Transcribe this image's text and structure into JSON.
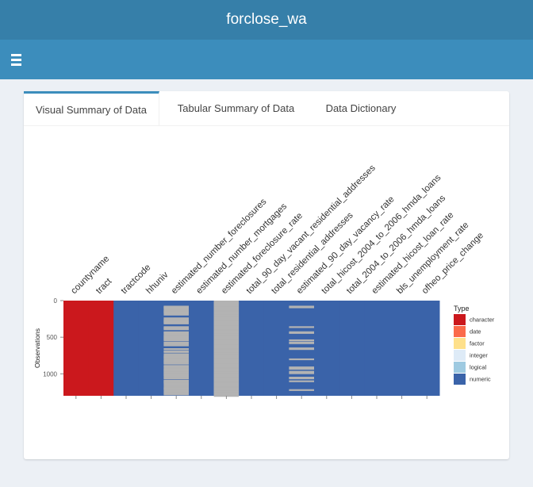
{
  "app": {
    "title": "forclose_wa"
  },
  "tabs": [
    {
      "label": "Visual Summary of Data",
      "active": true
    },
    {
      "label": "Tabular Summary of Data",
      "active": false
    },
    {
      "label": "Data Dictionary",
      "active": false
    }
  ],
  "icons": {
    "menu": "hamburger-menu-icon"
  },
  "chart_data": {
    "type": "heatmap",
    "title": "",
    "xlabel": "",
    "ylabel": "Observations",
    "ylim": [
      0,
      1300
    ],
    "yticks": [
      0,
      500,
      1000
    ],
    "variables": [
      "countyname",
      "tract",
      "tractcode",
      "hhuniv",
      "estimated_number_foreclosures",
      "estimated_number_mortgages",
      "estimated_foreclosure_rate",
      "total_90_day_vacant_residential_addresses",
      "total_residential_addresses",
      "estimated_90_day_vacancy_rate",
      "total_hicost_2004_to_2006_hmda_loans",
      "total_2004_to_2006_hmda_loans",
      "estimated_hicost_loan_rate",
      "bls_unemployment_rate",
      "ofheo_price_change"
    ],
    "column_types": [
      "character",
      "character",
      "numeric",
      "numeric",
      "numeric",
      "numeric",
      "numeric",
      "numeric",
      "numeric",
      "numeric",
      "numeric",
      "numeric",
      "numeric",
      "numeric",
      "numeric"
    ],
    "missing_rows": {
      "estimated_number_foreclosures": [
        70,
        80,
        90,
        100,
        120,
        130,
        140,
        150,
        160,
        180,
        230,
        250,
        260,
        270,
        280,
        290,
        300,
        350,
        360,
        370,
        380,
        420,
        430,
        440,
        460,
        470,
        480,
        490,
        500,
        510,
        520,
        530,
        560,
        570,
        590,
        600,
        650,
        680,
        690,
        720,
        740,
        750,
        760,
        770,
        780,
        800,
        810,
        820,
        830,
        840,
        850,
        880,
        890,
        900,
        920,
        930,
        940,
        950,
        960,
        970,
        980,
        990,
        1000,
        1010,
        1020,
        1040,
        1050,
        1080,
        1090,
        1100,
        1110,
        1120,
        1140,
        1160,
        1180,
        1190,
        1200,
        1220,
        1240,
        1250,
        1270
      ],
      "estimated_foreclosure_rate": [
        0,
        10,
        20,
        30,
        40,
        50,
        60,
        70,
        80,
        90,
        100,
        110,
        120,
        130,
        140,
        150,
        160,
        170,
        180,
        190,
        200,
        210,
        220,
        230,
        240,
        250,
        260,
        270,
        280,
        290,
        300,
        310,
        320,
        330,
        340,
        350,
        360,
        370,
        380,
        390,
        400,
        410,
        420,
        430,
        440,
        450,
        460,
        470,
        480,
        490,
        500,
        510,
        520,
        530,
        540,
        550,
        560,
        570,
        580,
        590,
        600,
        610,
        620,
        630,
        640,
        650,
        660,
        670,
        680,
        690,
        700,
        710,
        720,
        730,
        740,
        750,
        760,
        770,
        780,
        790,
        800,
        810,
        820,
        830,
        840,
        850,
        860,
        870,
        880,
        890,
        900,
        910,
        920,
        930,
        940,
        950,
        960,
        970,
        980,
        990,
        1000,
        1010,
        1020,
        1030,
        1040,
        1050,
        1060,
        1070,
        1080,
        1090,
        1100,
        1110,
        1120,
        1130,
        1140,
        1150,
        1160,
        1170,
        1180,
        1190,
        1200,
        1210,
        1220,
        1230,
        1240,
        1250,
        1260,
        1270,
        1280,
        1290
      ],
      "estimated_90_day_vacancy_rate": [
        70,
        80,
        350,
        420,
        430,
        530,
        560,
        570,
        640,
        650,
        790,
        900,
        920,
        960,
        980,
        1040,
        1050,
        1090,
        1210
      ]
    },
    "legend": {
      "title": "Type",
      "position": "right",
      "entries": [
        {
          "label": "character",
          "color": "#cb181d"
        },
        {
          "label": "date",
          "color": "#fb6a4a"
        },
        {
          "label": "factor",
          "color": "#fee08b"
        },
        {
          "label": "integer",
          "color": "#deebf7"
        },
        {
          "label": "logical",
          "color": "#9ecae1"
        },
        {
          "label": "numeric",
          "color": "#3a63a9"
        }
      ]
    },
    "missing_color": "#b3b3b3"
  }
}
